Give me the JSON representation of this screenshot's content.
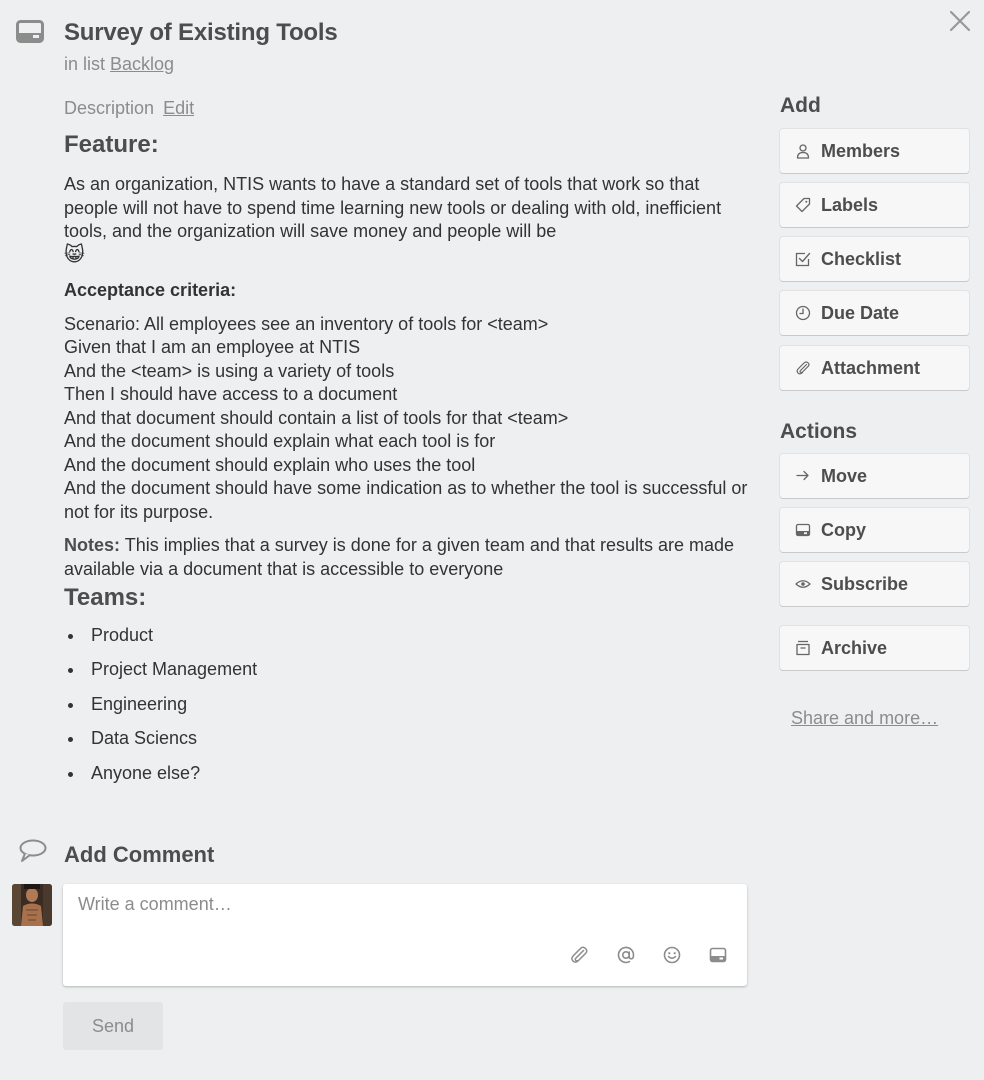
{
  "card": {
    "title": "Survey of Existing Tools",
    "in_list_prefix": "in list",
    "list_name": "Backlog"
  },
  "description": {
    "heading": "Description",
    "edit_label": "Edit",
    "feature_heading": "Feature:",
    "feature_text": "As an organization, NTIS wants to have a standard set of tools that work so that people will not have to spend time learning new tools or dealing with old, inefficient tools, and the organization will save money and people will be",
    "feature_emoji": "😸",
    "acceptance_heading": "Acceptance criteria:",
    "scenario_lines": [
      "Scenario: All employees see an inventory of tools for <team>",
      "Given that I am an employee at NTIS",
      "And the <team> is using a variety of tools",
      "Then I should have access to a document",
      "And that document should contain a list of tools for that <team>",
      "And the document should explain what each tool is for",
      "And the document should explain who uses the tool",
      "And the document should have some indication as to whether the tool is successful or not for its purpose."
    ],
    "notes_label": "Notes:",
    "notes_text": "This implies that a survey is done for a given team and that results are made available via a document that is accessible to everyone",
    "teams_heading": "Teams:",
    "teams": [
      "Product",
      "Project Management",
      "Engineering",
      "Data Sciencs",
      "Anyone else?"
    ]
  },
  "comment": {
    "heading": "Add Comment",
    "placeholder": "Write a comment…",
    "send_label": "Send",
    "icons": [
      "attachment-icon",
      "mention-icon",
      "emoji-icon",
      "card-icon"
    ]
  },
  "sidebar": {
    "add_heading": "Add",
    "add_buttons": [
      {
        "label": "Members",
        "icon": "person-icon"
      },
      {
        "label": "Labels",
        "icon": "tag-icon"
      },
      {
        "label": "Checklist",
        "icon": "checkbox-icon"
      },
      {
        "label": "Due Date",
        "icon": "clock-icon"
      },
      {
        "label": "Attachment",
        "icon": "paperclip-icon"
      }
    ],
    "actions_heading": "Actions",
    "action_buttons": [
      {
        "label": "Move",
        "icon": "arrow-right-icon"
      },
      {
        "label": "Copy",
        "icon": "card-icon"
      },
      {
        "label": "Subscribe",
        "icon": "eye-icon"
      },
      {
        "label": "Archive",
        "icon": "archive-icon"
      }
    ],
    "share_label": "Share and more…"
  },
  "colors": {
    "background": "#edeff0",
    "button_bg": "#f7f7f7",
    "muted_text": "#8c8c8c",
    "heading_text": "#4d4d4d"
  }
}
